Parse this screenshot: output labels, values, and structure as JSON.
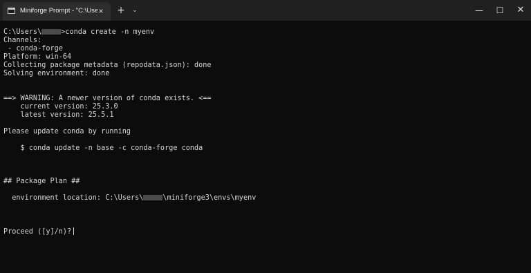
{
  "tab": {
    "icon": "terminal-icon",
    "title": "Miniforge Prompt - \"C:\\Users\\",
    "close_glyph": "×"
  },
  "titlebar": {
    "new_tab_glyph": "+",
    "dropdown_glyph": "⌄",
    "minimize_glyph": "—",
    "maximize_glyph": "☐",
    "close_glyph": "✕"
  },
  "terminal": {
    "prompt_prefix": "C:\\Users\\",
    "prompt_command": ">conda create -n myenv",
    "lines_a": [
      "Channels:",
      " - conda-forge",
      "Platform: win-64",
      "Collecting package metadata (repodata.json): done",
      "Solving environment: done"
    ],
    "lines_b": [
      "==> WARNING: A newer version of conda exists. <==",
      "    current version: 25.3.0",
      "    latest version: 25.5.1"
    ],
    "update_msg": "Please update conda by running",
    "update_cmd": "    $ conda update -n base -c conda-forge conda",
    "plan_header": "## Package Plan ##",
    "env_location_prefix": "  environment location: C:\\Users\\",
    "env_location_suffix": "\\miniforge3\\envs\\myenv",
    "proceed": "Proceed ([y]/n)?"
  },
  "colors": {
    "background": "#0c0c0c",
    "titlebar": "#202020",
    "tab": "#2d2d2d",
    "text": "#d6d6d6"
  }
}
